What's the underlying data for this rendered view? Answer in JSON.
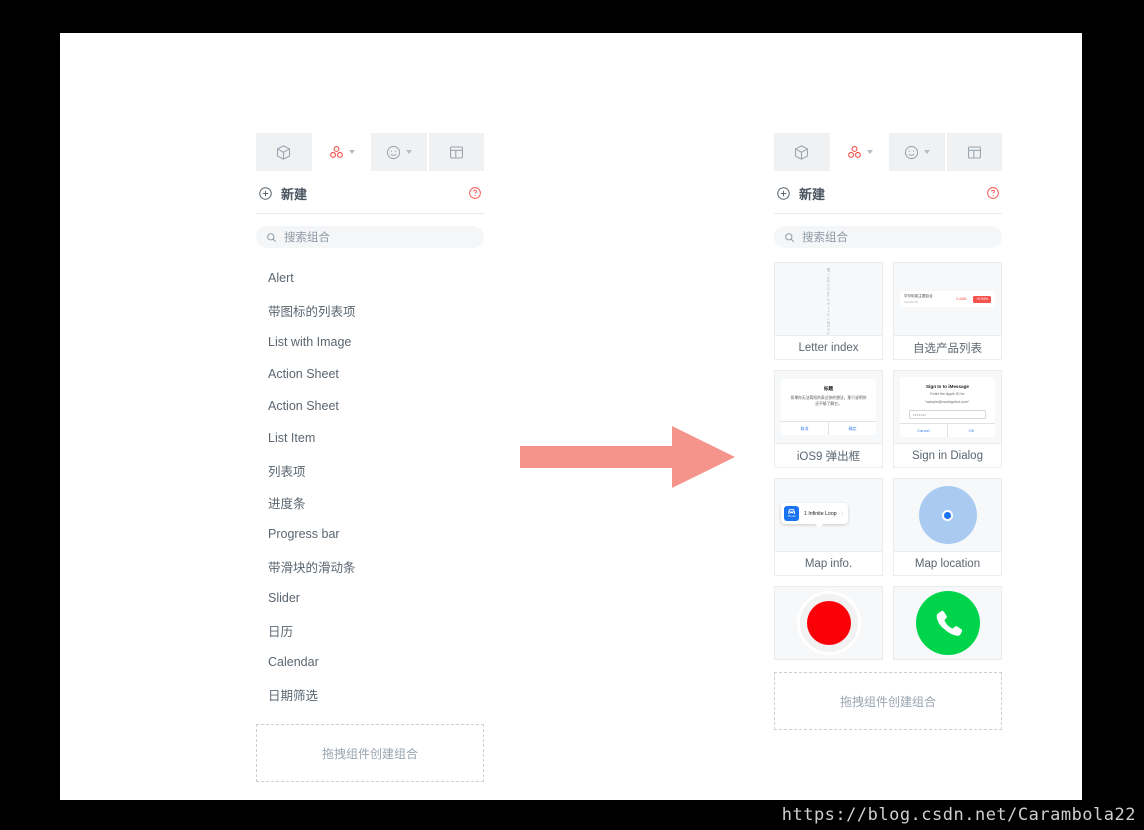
{
  "watermark": "https://blog.csdn.net/Carambola22",
  "toolbar": {
    "icons": [
      {
        "name": "cube-icon",
        "label": "组件",
        "has_caret": false,
        "active": true
      },
      {
        "name": "molecule-icon",
        "label": "组合",
        "has_caret": true,
        "active": false
      },
      {
        "name": "smiley-icon",
        "label": "图标",
        "has_caret": true,
        "active": true
      },
      {
        "name": "layout-icon",
        "label": "布局",
        "has_caret": false,
        "active": false
      }
    ]
  },
  "header": {
    "new_label": "新建",
    "plus_icon": "plus-circle-icon",
    "help_icon": "question-circle-icon"
  },
  "search": {
    "placeholder": "搜索组合",
    "icon": "search-icon"
  },
  "left_panel": {
    "components": [
      "Alert",
      "带图标的列表项",
      "List with Image",
      "Action Sheet",
      "Action Sheet",
      "List Item",
      "列表项",
      "进度条",
      "Progress bar",
      "带滑块的滑动条",
      "Slider",
      "日历",
      "Calendar",
      "日期筛选"
    ],
    "dropzone_text": "拖拽组件创建组合"
  },
  "right_panel": {
    "dropzone_text": "拖拽组件创建组合",
    "cards": [
      {
        "id": "letter-index",
        "label": "Letter index",
        "thumb": "letter-index",
        "letters": [
          "搜",
          "☆",
          "A",
          "B",
          "C",
          "D",
          "E",
          "F",
          "G",
          "H",
          "I",
          "J",
          "K",
          "L",
          "M",
          "N",
          "O",
          "P",
          "Q",
          "R",
          "S",
          "T",
          "U",
          "V",
          "W",
          "X",
          "Y",
          "Z",
          "#"
        ]
      },
      {
        "id": "product-list",
        "label": "自选产品列表",
        "thumb": "product-list",
        "row": {
          "name": "华尔街英主题百合",
          "code": "SH600000",
          "price": "3.4565",
          "badge": "+0.54%"
        }
      },
      {
        "id": "ios9-alert",
        "label": "iOS9 弹出框",
        "thumb": "ios9-alert",
        "dialog": {
          "title": "标题",
          "message": "如果你无法简短的表达你的想法，那只说明你还不够了解它。",
          "cancel": "取消",
          "confirm": "确定"
        }
      },
      {
        "id": "sign-in-dialog",
        "label": "Sign in Dialog",
        "thumb": "sign-in-dialog",
        "dialog": {
          "title": "Sign In to iMessage",
          "sub_line1": "Enter the Apple ID for",
          "sub_line2": "\"sample@mockignbot.com\".",
          "password_value": "•••••••",
          "cancel": "Cancel",
          "ok": "OK"
        }
      },
      {
        "id": "map-info",
        "label": "Map info.",
        "thumb": "map-info",
        "bubble": {
          "badge_icon": "car-icon",
          "badge_time": "15 min",
          "address": "1 Infinite Loop",
          "chevron": "chevron-right-icon"
        }
      },
      {
        "id": "map-location",
        "label": "Map location",
        "thumb": "map-location",
        "dot_icon": "location-dot-icon"
      },
      {
        "id": "record-button",
        "label": "",
        "thumb": "record-button",
        "icon": "record-circle-icon"
      },
      {
        "id": "call-button",
        "label": "",
        "thumb": "call-button",
        "icon": "phone-icon"
      }
    ]
  },
  "arrow": {
    "name": "right-arrow",
    "color": "#f4948a"
  },
  "colors": {
    "accent_red": "#f4524d",
    "icon_gray": "#9aa5b0",
    "text": "#5b6670",
    "blue": "#1a73f0",
    "green": "#00d44b"
  }
}
